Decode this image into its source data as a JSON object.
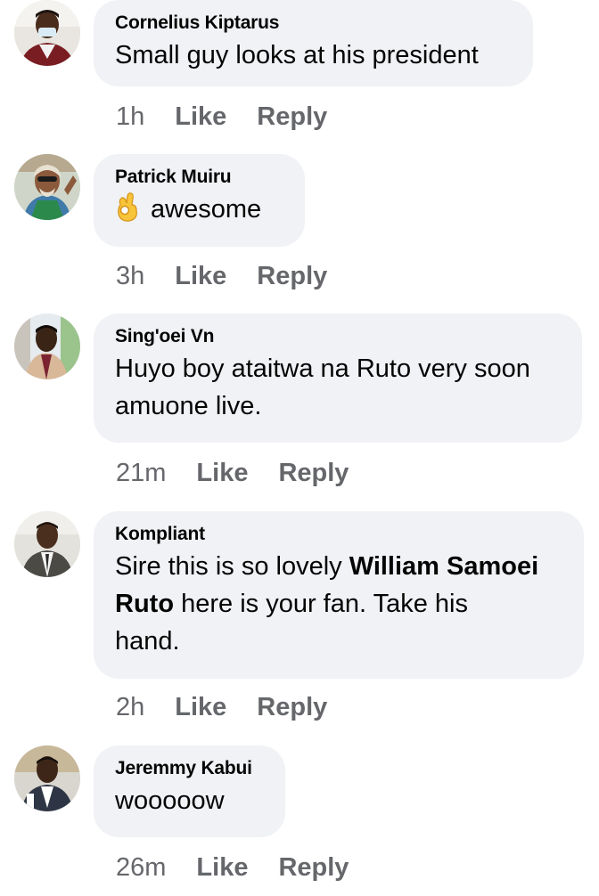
{
  "comments": [
    {
      "author": "Cornelius Kiptarus",
      "text": "Small guy looks at his president",
      "time": "1h",
      "like": "Like",
      "reply": "Reply"
    },
    {
      "author": "Patrick Muiru",
      "emoji": "ok-hand-emoji",
      "text": "awesome",
      "time": "3h",
      "like": "Like",
      "reply": "Reply"
    },
    {
      "author": "Sing'oei Vn",
      "text_line1": "Huyo boy ataitwa na Ruto very soon",
      "text_line2": "amuone live.",
      "time": "21m",
      "like": "Like",
      "reply": "Reply"
    },
    {
      "author": "Kompliant",
      "text_part1": "Sire this is so lovely ",
      "mention_part1": "William Samoei",
      "mention_part2": "Ruto",
      "text_part2": " here is your fan. Take his",
      "text_part3": "hand.",
      "time": "2h",
      "like": "Like",
      "reply": "Reply"
    },
    {
      "author": "Jeremmy Kabui",
      "text": "wooooow",
      "time": "26m",
      "like": "Like",
      "reply": "Reply"
    }
  ],
  "colors": {
    "bubble": "#f0f2f5",
    "text": "#050505",
    "meta": "#65676b"
  }
}
